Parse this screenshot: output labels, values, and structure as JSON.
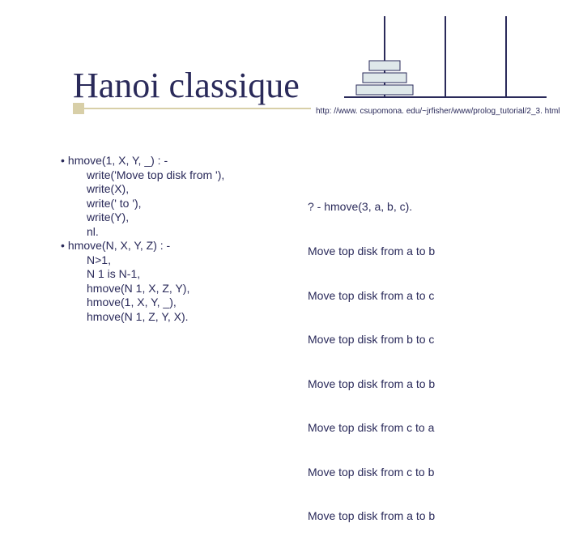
{
  "title": "Hanoi classique",
  "url": "http: //www. csupomona. edu/~jrfisher/www/prolog_tutorial/2_3. html",
  "code": {
    "l0": "hmove(1, X, Y, _) : -",
    "l1": "write('Move top disk from '),",
    "l2": "write(X),",
    "l3": "write(' to '),",
    "l4": "write(Y),",
    "l5": "nl.",
    "l6": "hmove(N, X, Y, Z) : -",
    "l7": "N>1,",
    "l8": "N 1 is N-1,",
    "l9": "hmove(N 1, X, Z, Y),",
    "l10": "hmove(1, X, Y, _),",
    "l11": "hmove(N 1, Z, Y, X)."
  },
  "output": {
    "q": "? - hmove(3, a, b, c).",
    "m0": "Move top disk from a to b",
    "m1": "Move top disk from a to c",
    "m2": "Move top disk from b to c",
    "m3": "Move top disk from a to b",
    "m4": "Move top disk from c to a",
    "m5": "Move top disk from c to b",
    "m6": "Move top disk from a to b"
  },
  "chart_data": {
    "type": "diagram",
    "title": "Towers of Hanoi",
    "pegs": 3,
    "disks_on_peg1": 3,
    "disks_on_peg2": 0,
    "disks_on_peg3": 0
  }
}
